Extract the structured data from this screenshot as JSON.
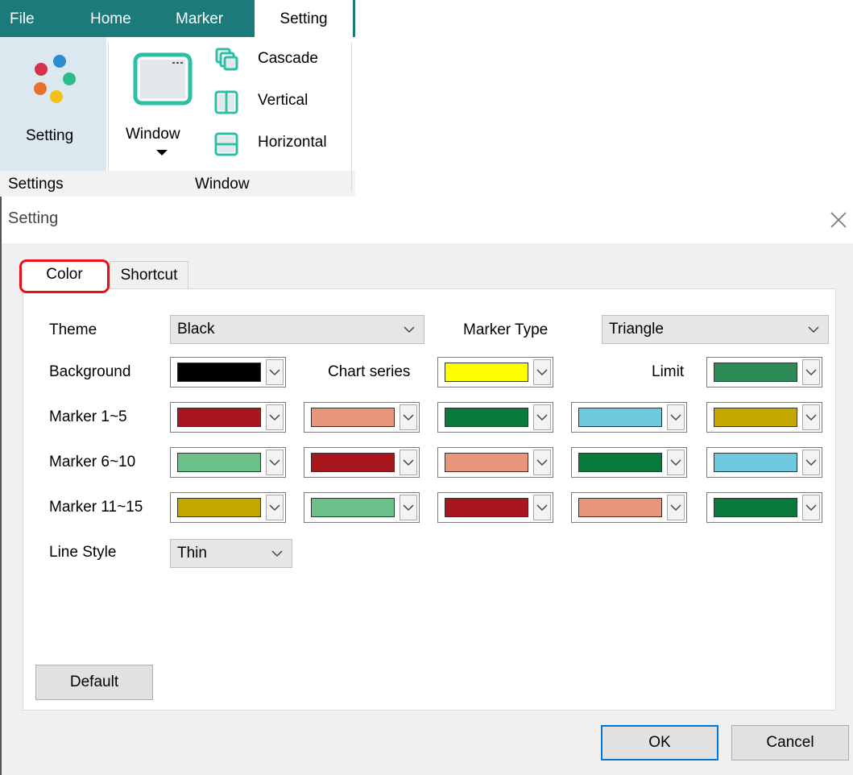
{
  "ribbon": {
    "tabs": [
      "File",
      "Home",
      "Marker",
      "Setting"
    ],
    "setting_button": "Setting",
    "window_button": "Window",
    "window_items": [
      "Cascade",
      "Vertical",
      "Horizontal"
    ],
    "groups": [
      "Settings",
      "Window"
    ],
    "icon_colors": [
      "#2e8bd0",
      "#d6304a",
      "#2dbb8a",
      "#e8702a",
      "#f2c21b"
    ]
  },
  "dialog": {
    "title": "Setting",
    "tabs": [
      "Color",
      "Shortcut"
    ],
    "theme": {
      "label": "Theme",
      "value": "Black"
    },
    "marker_type": {
      "label": "Marker Type",
      "value": "Triangle"
    },
    "background": {
      "label": "Background",
      "color": "#000000"
    },
    "chart_series": {
      "label": "Chart series",
      "color": "#ffff00"
    },
    "limit": {
      "label": "Limit",
      "color": "#2e8b57"
    },
    "marker_rows": [
      {
        "label": "Marker 1~5",
        "colors": [
          "#a8171d",
          "#e8967a",
          "#087b3c",
          "#6ec8de",
          "#c4a800"
        ]
      },
      {
        "label": "Marker 6~10",
        "colors": [
          "#6cc08a",
          "#a8171d",
          "#e8967a",
          "#087b3c",
          "#6ec8de"
        ]
      },
      {
        "label": "Marker 11~15",
        "colors": [
          "#c4a800",
          "#6cc08a",
          "#a8171d",
          "#e8967a",
          "#087b3c"
        ]
      }
    ],
    "line_style": {
      "label": "Line Style",
      "value": "Thin"
    },
    "default_button": "Default",
    "ok_button": "OK",
    "cancel_button": "Cancel"
  }
}
